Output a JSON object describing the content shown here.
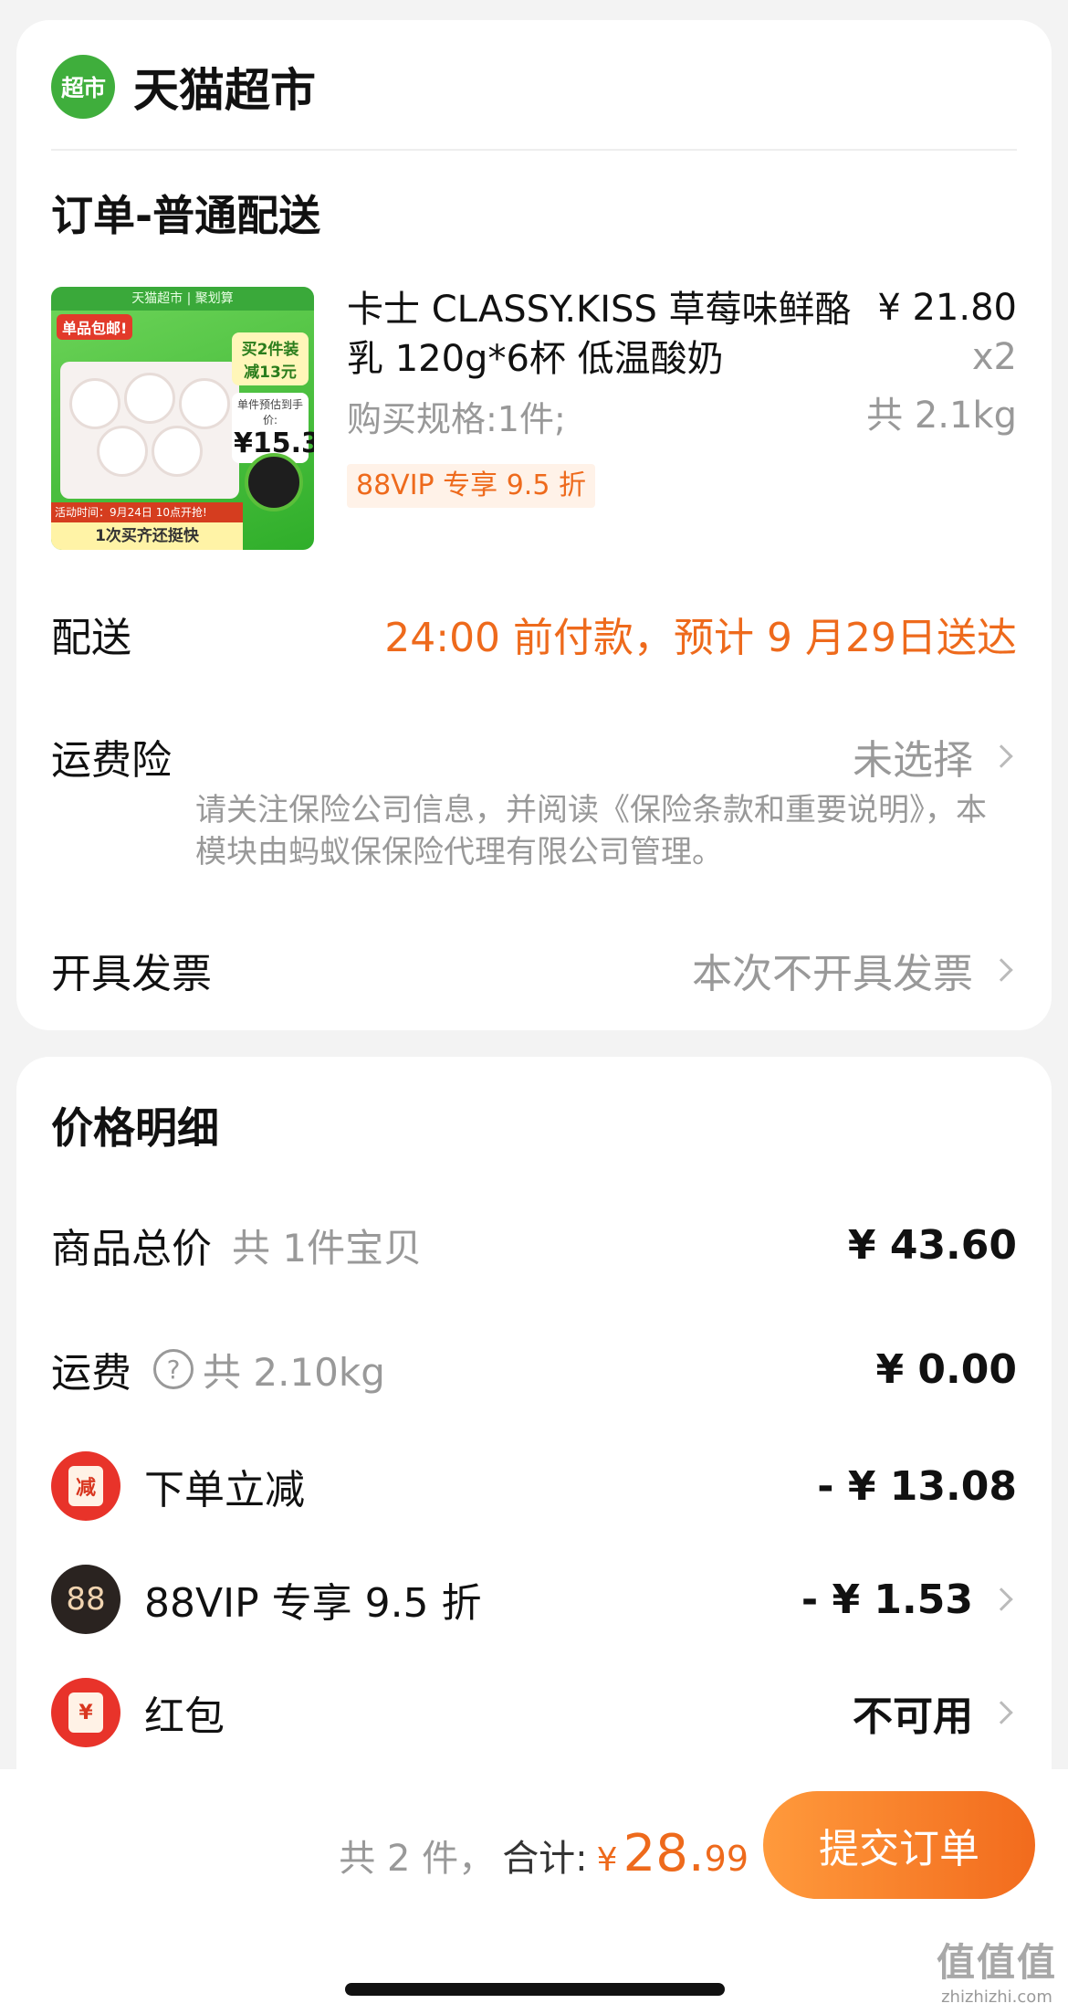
{
  "shop": {
    "logo_text": "超市",
    "name": "天猫超市"
  },
  "order": {
    "section_title": "订单-普通配送",
    "product": {
      "thumb": {
        "band": "天猫超市 | 聚划算",
        "tag": "单品包邮!",
        "promo": "买2件装 减13元",
        "promo_price_label": "单件预估到手价:",
        "promo_price": "¥15.3",
        "activity": "活动时间：9月24日 10点开抢!",
        "footer": "1次买齐还挺快"
      },
      "title": "卡士 CLASSY.KISS 草莓味鲜酪乳 120g*6杯 低温酸奶",
      "spec": "购买规格:1件;",
      "vip_chip": "88VIP 专享 9.5 折",
      "price": "¥ 21.80",
      "qty": "x2",
      "weight": "共 2.1kg"
    },
    "delivery": {
      "label": "配送",
      "value": "24:00 前付款，预计 9 月29日送达"
    },
    "shipping_insurance": {
      "label": "运费险",
      "value": "未选择",
      "note": "请关注保险公司信息，并阅读《保险条款和重要说明》，本模块由蚂蚁保保险代理有限公司管理。"
    },
    "invoice": {
      "label": "开具发票",
      "value": "本次不开具发票"
    }
  },
  "price_detail": {
    "title": "价格明细",
    "goods_total": {
      "label": "商品总价",
      "sub": "共 1件宝贝",
      "value": "¥ 43.60"
    },
    "shipping": {
      "label": "运费",
      "q_icon": "?",
      "sub": "共 2.10kg",
      "value": "¥ 0.00"
    },
    "instant_discount": {
      "icon_text": "减",
      "label": "下单立减",
      "value": "- ¥ 13.08"
    },
    "vip_discount": {
      "icon_text": "88",
      "label": "88VIP 专享 9.5 折",
      "value": "- ¥ 1.53"
    },
    "red_packet": {
      "icon_text": "¥",
      "label": "红包",
      "value": "不可用"
    }
  },
  "bottom": {
    "count": "共 2 件，",
    "total_label": "合计:",
    "yen": "¥",
    "total_int": "28.",
    "total_dec": "99",
    "submit": "提交订单"
  },
  "watermark": {
    "mark": "值值值",
    "url": "zhizhizhi.com"
  },
  "colors": {
    "accent": "#ee6a1c",
    "brand_green": "#3fae3c",
    "discount_red": "#e8332a"
  }
}
